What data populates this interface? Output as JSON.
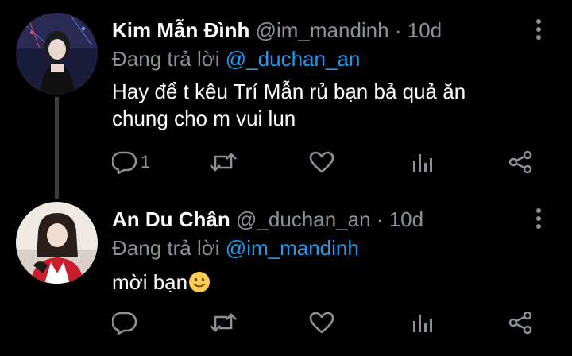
{
  "tweets": [
    {
      "name": "Kim Mẫn Đình",
      "handle": "@im_mandinh",
      "separator": "·",
      "time": "10d",
      "reply_prefix": "Đang trả lời",
      "reply_to": "@_duchan_an",
      "text": "Hay để t kêu Trí Mẫn rủ bạn bả quả ăn chung cho m vui lun",
      "reply_count": "1"
    },
    {
      "name": "An Du Chân",
      "handle": "@_duchan_an",
      "separator": "·",
      "time": "10d",
      "reply_prefix": "Đang trả lời",
      "reply_to": "@im_mandinh",
      "text": "mời bạn",
      "emoji": "slightly-smiling-face",
      "reply_count": ""
    }
  ],
  "colors": {
    "background": "#000000",
    "name": "#ffffff",
    "secondary": "#8b9197",
    "accent": "#1d9bf0",
    "thread_line": "#3a3d41"
  },
  "icons": [
    "reply-icon",
    "retweet-icon",
    "like-icon",
    "analytics-icon",
    "share-icon",
    "more-icon"
  ]
}
